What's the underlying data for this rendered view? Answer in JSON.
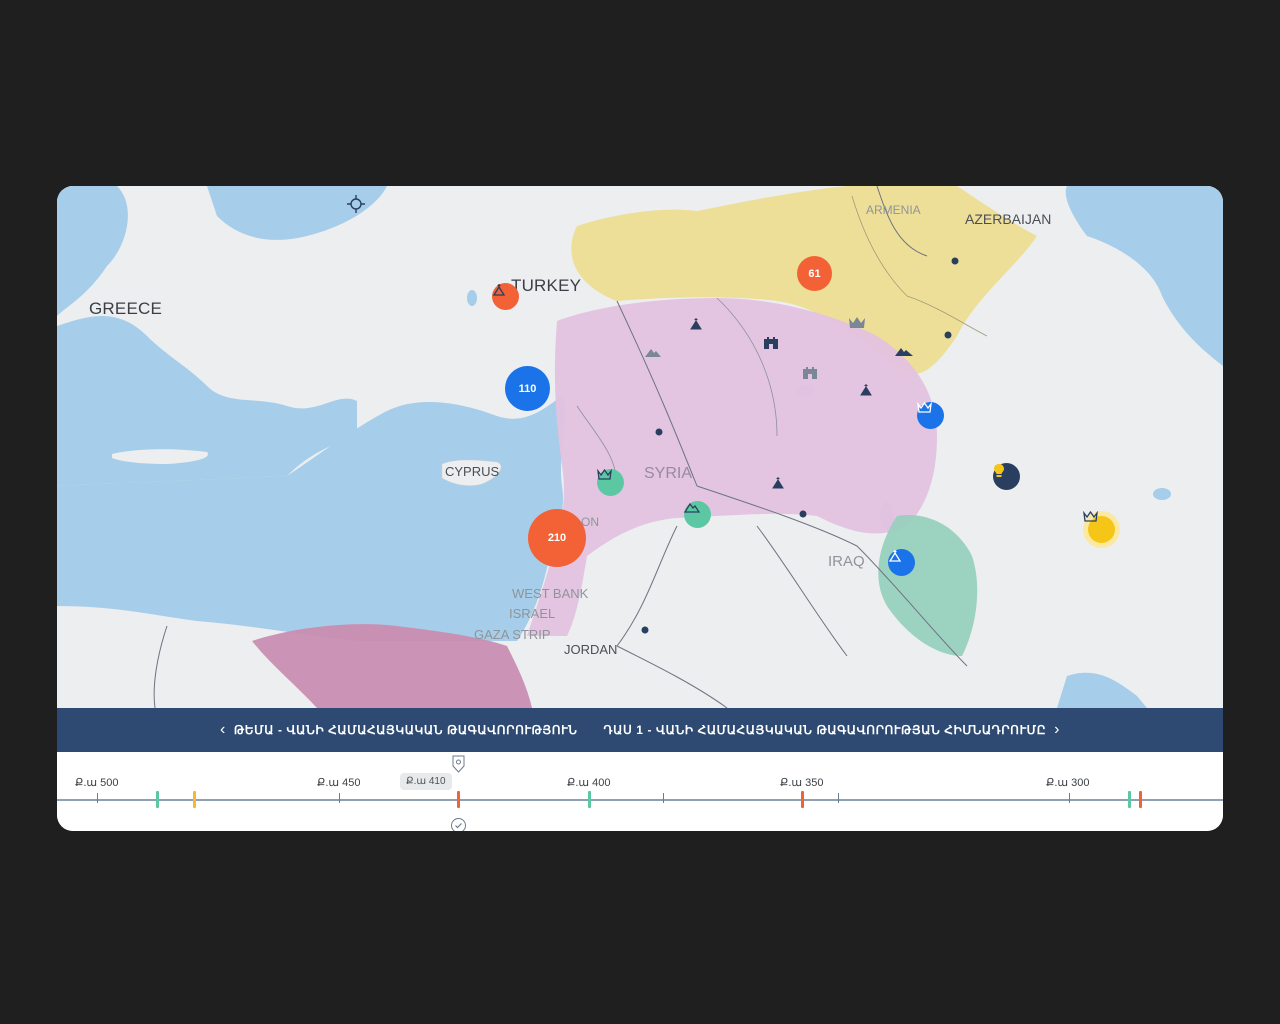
{
  "map": {
    "countries": {
      "turkey": "TURKEY",
      "greece": "GREECE",
      "cyprus": "CYPRUS",
      "syria": "SYRIA",
      "armenia": "ARMENIA",
      "azerbaijan": "AZERBAIJAN",
      "iraq": "IRAQ",
      "west_bank": "WEST BANK",
      "israel": "ISRAEL",
      "gaza_strip": "GAZA STRIP",
      "jordan": "JORDAN",
      "lebanon_partial": "ON"
    },
    "clusters": {
      "c110": "110",
      "c210": "210",
      "c61": "61"
    },
    "colors": {
      "water": "#a6cde9",
      "land": "#eceef0",
      "region_yellow": "#eedd8e",
      "region_pink": "#e3c2df",
      "region_magenta": "#c98db1",
      "region_green": "#98d0bd",
      "cluster_blue": "#1a73e8",
      "cluster_orange": "#f26236"
    }
  },
  "navbar": {
    "prev_icon": "chevron-left-icon",
    "topic": "ԹԵՄԱ - ՎԱՆԻ ՀԱՄԱՀԱՅԿԱԿԱՆ ԹԱԳԱՎՈՐՈՒԹՅՈՒՆ",
    "lesson": "ԴԱՍ 1 - ՎԱՆԻ ՀԱՄԱՀԱՅԿԱԿԱՆ ԹԱԳԱՎՈՐՈՒԹՅԱՆ ՀԻՄՆԱԴՐՈՒՄԸ",
    "next_icon": "chevron-right-icon"
  },
  "timeline": {
    "labels": [
      "Ք.ա 500",
      "Ք.ա 450",
      "Ք.ա 400",
      "Ք.ա 350",
      "Ք.ա 300"
    ],
    "current": "Ք.ա 410",
    "event_colors": {
      "green": "#5cc8a3",
      "orange": "#f26236",
      "yellow": "#f5b82e"
    }
  }
}
